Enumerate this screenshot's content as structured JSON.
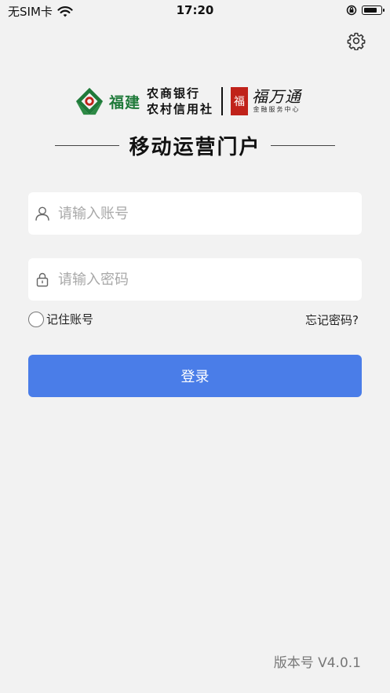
{
  "status_bar": {
    "carrier": "无SIM卡",
    "time": "17:20"
  },
  "logo": {
    "bank_name_big": "福建",
    "bank_name_line1": "农商银行",
    "bank_name_line2": "农村信用社",
    "seal_char": "福",
    "brand_name": "福万通",
    "brand_subtitle": "金融服务中心",
    "colors": {
      "bank_green": "#1f7a3a",
      "seal_red": "#c0221a"
    }
  },
  "title": "移动运营门户",
  "form": {
    "username_placeholder": "请输入账号",
    "username_value": "",
    "password_placeholder": "请输入密码",
    "password_value": "",
    "remember_label": "记住账号",
    "remember_checked": false,
    "forgot_label": "忘记密码?",
    "login_label": "登录"
  },
  "icons": {
    "settings": "gear-icon",
    "user": "user-icon",
    "lock": "lock-icon"
  },
  "colors": {
    "background": "#f2f2f2",
    "primary": "#4a7de8"
  },
  "version": "版本号 V4.0.1"
}
